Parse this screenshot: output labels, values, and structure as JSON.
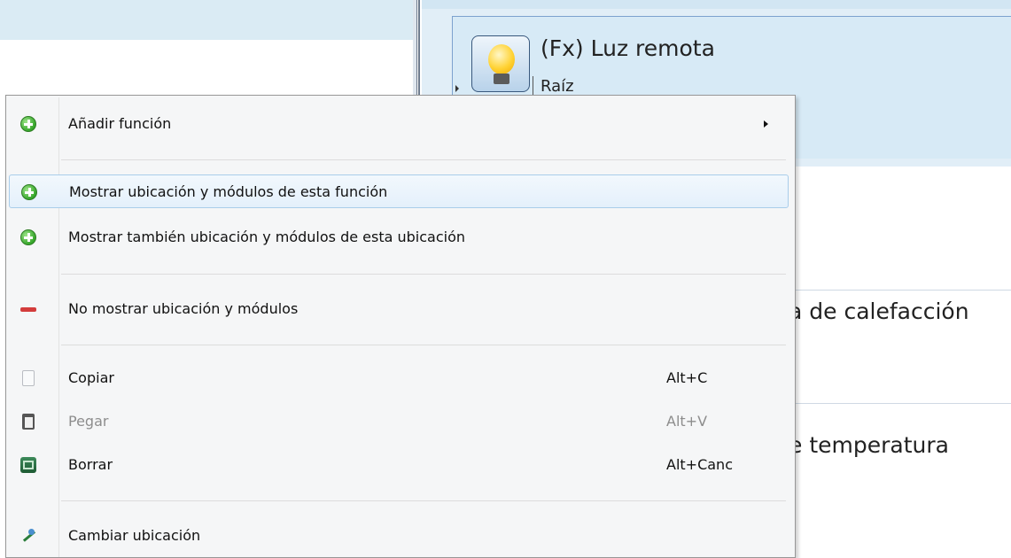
{
  "background": {
    "node": {
      "title": "(Fx) Luz remota",
      "subtitle": "Raíz",
      "icon": "light-bulb-icon"
    },
    "rows": [
      "a de calefacción",
      "e temperatura"
    ]
  },
  "context_menu": {
    "items": [
      {
        "label": "Añadir función",
        "icon": "add-icon",
        "has_submenu": true
      },
      {
        "label": "Mostrar ubicación y módulos de esta función",
        "icon": "add-icon",
        "highlighted": true
      },
      {
        "label": "Mostrar también ubicación y módulos de esta ubicación",
        "icon": "add-icon"
      },
      {
        "label": "No mostrar ubicación y módulos",
        "icon": "remove-icon"
      },
      {
        "label": "Copiar",
        "shortcut": "Alt+C",
        "icon": "copy-icon"
      },
      {
        "label": "Pegar",
        "shortcut": "Alt+V",
        "icon": "paste-icon",
        "disabled": true
      },
      {
        "label": "Borrar",
        "shortcut": "Alt+Canc",
        "icon": "delete-icon"
      },
      {
        "label": "Cambiar ubicación",
        "icon": "move-icon"
      }
    ]
  },
  "colors": {
    "menu_background": "#f5f6f7",
    "highlight_border": "#a9cdea",
    "selected_node_background": "#d7eaf6",
    "add_icon": "#35a62a",
    "remove_icon": "#d33c3c"
  }
}
